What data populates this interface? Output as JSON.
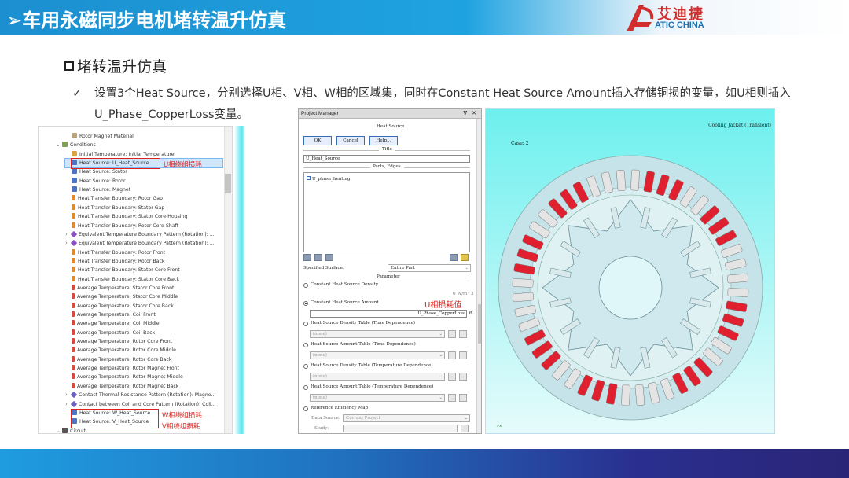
{
  "header": {
    "title": "➢车用永磁同步电机堵转温升仿真",
    "logo_cn": "艾迪捷",
    "logo_en": "ATIC CHINA"
  },
  "section": {
    "title": "堵转温升仿真"
  },
  "bullet": {
    "check": "✓",
    "text": "设置3个Heat Source，分别选择U相、V相、W相的区域集，同时在Constant Heat Source Amount插入存储铜损的变量，如U相则插入U_Phase_CopperLoss变量。"
  },
  "tree": {
    "items": [
      {
        "label": "Rotor Magnet Material",
        "icon": "material-icon",
        "indent": 2,
        "expander": ""
      },
      {
        "label": "Conditions",
        "icon": "conditions-icon",
        "indent": 1,
        "expander": "⌄"
      },
      {
        "label": "Initial Temperature: Initial Temperature",
        "icon": "initial-temperature-icon",
        "indent": 2,
        "expander": ""
      },
      {
        "label": "Heat Source: U_Heat_Source",
        "icon": "heat-source-icon",
        "indent": 2,
        "expander": "",
        "selected": true
      },
      {
        "label": "Heat Source: Stator",
        "icon": "heat-source-icon",
        "indent": 2,
        "expander": ""
      },
      {
        "label": "Heat Source: Rotor",
        "icon": "heat-source-icon",
        "indent": 2,
        "expander": ""
      },
      {
        "label": "Heat Source: Magnet",
        "icon": "heat-source-icon",
        "indent": 2,
        "expander": ""
      },
      {
        "label": "Heat Transfer Boundary: Rotor Gap",
        "icon": "heat-transfer-icon",
        "indent": 2,
        "expander": ""
      },
      {
        "label": "Heat Transfer Boundary: Stator Gap",
        "icon": "heat-transfer-icon",
        "indent": 2,
        "expander": ""
      },
      {
        "label": "Heat Transfer Boundary: Stator Core-Housing",
        "icon": "heat-transfer-icon",
        "indent": 2,
        "expander": ""
      },
      {
        "label": "Heat Transfer Boundary: Rotor Core-Shaft",
        "icon": "heat-transfer-icon",
        "indent": 2,
        "expander": ""
      },
      {
        "label": "Equivalent Temperature Boundary Pattern (Rotation): ...",
        "icon": "equivalent-temperature-icon",
        "indent": 2,
        "expander": "›"
      },
      {
        "label": "Equivalent Temperature Boundary Pattern (Rotation): ...",
        "icon": "equivalent-temperature-icon",
        "indent": 2,
        "expander": "›"
      },
      {
        "label": "Heat Transfer Boundary: Rotor Front",
        "icon": "heat-transfer-icon",
        "indent": 2,
        "expander": ""
      },
      {
        "label": "Heat Transfer Boundary: Rotor Back",
        "icon": "heat-transfer-icon",
        "indent": 2,
        "expander": ""
      },
      {
        "label": "Heat Transfer Boundary: Stator Core Front",
        "icon": "heat-transfer-icon",
        "indent": 2,
        "expander": ""
      },
      {
        "label": "Heat Transfer Boundary: Stator Core Back",
        "icon": "heat-transfer-icon",
        "indent": 2,
        "expander": ""
      },
      {
        "label": "Average Temperature: Stator Core Front",
        "icon": "average-temperature-icon",
        "indent": 2,
        "expander": ""
      },
      {
        "label": "Average Temperature: Stator Core Middle",
        "icon": "average-temperature-icon",
        "indent": 2,
        "expander": ""
      },
      {
        "label": "Average Temperature: Stator Core Back",
        "icon": "average-temperature-icon",
        "indent": 2,
        "expander": ""
      },
      {
        "label": "Average Temperature: Coil Front",
        "icon": "average-temperature-icon",
        "indent": 2,
        "expander": ""
      },
      {
        "label": "Average Temperature: Coil Middle",
        "icon": "average-temperature-icon",
        "indent": 2,
        "expander": ""
      },
      {
        "label": "Average Temperature: Coil Back",
        "icon": "average-temperature-icon",
        "indent": 2,
        "expander": ""
      },
      {
        "label": "Average Temperature: Rotor Core Front",
        "icon": "average-temperature-icon",
        "indent": 2,
        "expander": ""
      },
      {
        "label": "Average Temperature: Rotor Core Middle",
        "icon": "average-temperature-icon",
        "indent": 2,
        "expander": ""
      },
      {
        "label": "Average Temperature: Rotor Core Back",
        "icon": "average-temperature-icon",
        "indent": 2,
        "expander": ""
      },
      {
        "label": "Average Temperature: Rotor Magnet Front",
        "icon": "average-temperature-icon",
        "indent": 2,
        "expander": ""
      },
      {
        "label": "Average Temperature: Rotor Magnet Middle",
        "icon": "average-temperature-icon",
        "indent": 2,
        "expander": ""
      },
      {
        "label": "Average Temperature: Rotor Magnet Back",
        "icon": "average-temperature-icon",
        "indent": 2,
        "expander": ""
      },
      {
        "label": "Contact Thermal Resistance Pattern (Rotation): Magne...",
        "icon": "contact-resistance-icon",
        "indent": 2,
        "expander": "›"
      },
      {
        "label": "Contact between Coil and Core Pattern (Rotation): Coil...",
        "icon": "contact-resistance-icon",
        "indent": 2,
        "expander": "›"
      },
      {
        "label": "Heat Source: W_Heat_Source",
        "icon": "heat-source-icon",
        "indent": 2,
        "expander": ""
      },
      {
        "label": "Heat Source: V_Heat_Source",
        "icon": "heat-source-icon",
        "indent": 2,
        "expander": ""
      },
      {
        "label": "Circuit",
        "icon": "circuit-icon",
        "indent": 1,
        "expander": "⌄"
      }
    ]
  },
  "annotations": {
    "u_label": "U相绕组损耗",
    "w_label": "W相绕组损耗",
    "v_label": "V相绕组损耗",
    "amount_label": "U相损耗值"
  },
  "project_manager": {
    "window_title": "Project Manager",
    "window_controls": "ᐁ ✕",
    "dialog_title": "Heat Source",
    "ok_label": "OK",
    "cancel_label": "Cancel",
    "help_label": "Help...",
    "title_section": "Title",
    "title_value": "U_Heat_Source",
    "parts_section": "Parts, Edges",
    "parts_item": "U_phase_heating",
    "specified_surface_label": "Specified Surface:",
    "specified_surface_value": "Entire Part",
    "parameter_section": "Parameter",
    "options": [
      {
        "label": "Constant Heat Source Density",
        "selected": false
      },
      {
        "label": "Constant Heat Source Amount",
        "selected": true
      },
      {
        "label": "Heat Source Density Table (Time Dependence)",
        "selected": false
      },
      {
        "label": "Heat Source Amount Table (Time Dependence)",
        "selected": false
      },
      {
        "label": "Heat Source Density Table (Temperature Dependence)",
        "selected": false
      },
      {
        "label": "Heat Source Amount Table (Temperature Dependence)",
        "selected": false
      },
      {
        "label": "Reference Efficiency Map",
        "selected": false
      }
    ],
    "density_unit": "0  W/m^3",
    "amount_value": "U_Phase_CopperLoss",
    "amount_unit": "W",
    "none_value": "(none)",
    "data_source_label": "Data Source:",
    "data_source_value": "Current Project",
    "study_label": "Study:"
  },
  "viewport": {
    "title": "Cooling Jacket (Transient)",
    "case": "Case: 2",
    "colors": {
      "background_top": "#6df0ee",
      "stator": "#c5e3e8",
      "coil_highlight": "#e0202f",
      "coil_normal": "#e4e4e4"
    }
  },
  "colors": {
    "header": "#1c8fd0",
    "annotation_red": "#e0201b",
    "footer_start": "#1f9ce0",
    "footer_end": "#2a2577"
  }
}
